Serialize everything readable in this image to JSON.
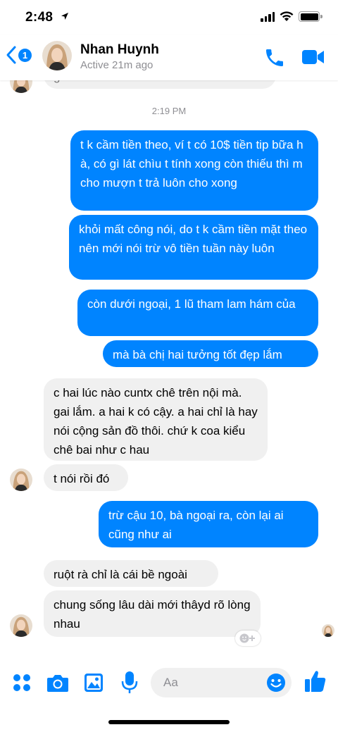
{
  "status_bar": {
    "time": "2:48"
  },
  "header": {
    "back_badge": "1",
    "contact_name": "Nhan Huynh",
    "contact_status": "Active 21m ago"
  },
  "conversation": {
    "partial_message_text": "g",
    "timestamp": "2:19 PM",
    "outgoing_group_1": [
      "t k cầm tiền theo, ví t có 10$ tiền tip bữa h à, có gì lát chìu t tính xong còn thiếu thì m cho mượn t trả luôn cho xong",
      "khỏi mất công nói, do t k cầm tiền mặt theo nên mới nói trừ vô tiền tuần này luôn",
      "còn dưới ngoại, 1 lũ tham lam hám của",
      "mà bà chị hai tưởng tốt đẹp lắm"
    ],
    "incoming_group_1": [
      "c hai lúc nào cuntx chê trên nội mà. gai lắm. a hai k có cậy. a hai chỉ là hay nói cộng sản đồ thôi. chứ k coa kiểu chê bai như c hau",
      "t nói rồi đó"
    ],
    "outgoing_group_2": [
      "trừ cậu 10, bà ngoại ra, còn lại ai cũng như ai"
    ],
    "incoming_group_2": [
      "ruột rà chỉ là cái bề ngoài",
      "chung sống lâu dài mới thâyd rõ lòng nhau"
    ]
  },
  "composer": {
    "placeholder": "Aa"
  },
  "icons": {
    "status": [
      "location-arrow-icon",
      "cellular-signal-icon",
      "wifi-icon",
      "battery-icon"
    ],
    "header": [
      "back-chevron-icon",
      "phone-icon",
      "video-camera-icon"
    ],
    "composer": [
      "apps-grid-icon",
      "camera-icon",
      "gallery-icon",
      "microphone-icon",
      "emoji-icon",
      "thumbs-up-icon"
    ]
  },
  "colors": {
    "accent": "#0084ff",
    "incoming_bubble": "#f0f0f0",
    "secondary_text": "#8e8e93"
  }
}
